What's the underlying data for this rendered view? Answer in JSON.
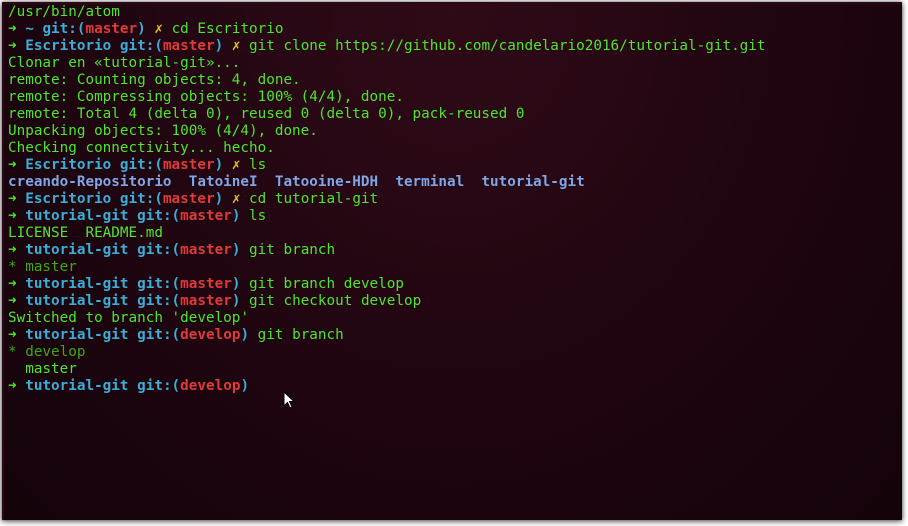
{
  "terminal": {
    "lines": [
      {
        "type": "output",
        "text": "/usr/bin/atom"
      },
      {
        "type": "prompt",
        "arrow": "➜",
        "dir": "~",
        "git": "git:(",
        "branch": "master",
        "git_close": ")",
        "dirty": "✗",
        "command": "cd Escritorio"
      },
      {
        "type": "prompt",
        "arrow": "➜",
        "dir": "Escritorio",
        "git": "git:(",
        "branch": "master",
        "git_close": ")",
        "dirty": "✗",
        "command": "git clone https://github.com/candelario2016/tutorial-git.git"
      },
      {
        "type": "output",
        "text": "Clonar en «tutorial-git»..."
      },
      {
        "type": "output",
        "text": "remote: Counting objects: 4, done."
      },
      {
        "type": "output",
        "text": "remote: Compressing objects: 100% (4/4), done."
      },
      {
        "type": "output",
        "text": "remote: Total 4 (delta 0), reused 0 (delta 0), pack-reused 0"
      },
      {
        "type": "output",
        "text": "Unpacking objects: 100% (4/4), done."
      },
      {
        "type": "output",
        "text": "Checking connectivity... hecho."
      },
      {
        "type": "prompt",
        "arrow": "➜",
        "dir": "Escritorio",
        "git": "git:(",
        "branch": "master",
        "git_close": ")",
        "dirty": "✗",
        "command": "ls"
      },
      {
        "type": "ls",
        "text": "creando-Repositorio  TatoineI  Tatooine-HDH  terminal  tutorial-git"
      },
      {
        "type": "prompt",
        "arrow": "➜",
        "dir": "Escritorio",
        "git": "git:(",
        "branch": "master",
        "git_close": ")",
        "dirty": "✗",
        "command": "cd tutorial-git"
      },
      {
        "type": "prompt",
        "arrow": "➜",
        "dir": "tutorial-git",
        "git": "git:(",
        "branch": "master",
        "git_close": ")",
        "dirty": "",
        "command": "ls"
      },
      {
        "type": "output",
        "text": "LICENSE  README.md"
      },
      {
        "type": "prompt",
        "arrow": "➜",
        "dir": "tutorial-git",
        "git": "git:(",
        "branch": "master",
        "git_close": ")",
        "dirty": "",
        "command": "git branch"
      },
      {
        "type": "branch-current",
        "text": "* master"
      },
      {
        "type": "prompt",
        "arrow": "➜",
        "dir": "tutorial-git",
        "git": "git:(",
        "branch": "master",
        "git_close": ")",
        "dirty": "",
        "command": "git branch develop"
      },
      {
        "type": "prompt",
        "arrow": "➜",
        "dir": "tutorial-git",
        "git": "git:(",
        "branch": "master",
        "git_close": ")",
        "dirty": "",
        "command": "git checkout develop"
      },
      {
        "type": "output",
        "text": "Switched to branch 'develop'"
      },
      {
        "type": "prompt",
        "arrow": "➜",
        "dir": "tutorial-git",
        "git": "git:(",
        "branch": "develop",
        "git_close": ")",
        "dirty": "",
        "command": "git branch"
      },
      {
        "type": "branch-current",
        "text": "* develop"
      },
      {
        "type": "branch-other",
        "text": "  master"
      },
      {
        "type": "prompt",
        "arrow": "➜",
        "dir": "tutorial-git",
        "git": "git:(",
        "branch": "develop",
        "git_close": ")",
        "dirty": "",
        "command": ""
      }
    ]
  },
  "colors": {
    "background": "#1f0510",
    "prompt_arrow": "#4ee52f",
    "directory": "#3aaed6",
    "branch": "#e03a3a",
    "dirty_marker": "#e8c21b",
    "output": "#4ee52f",
    "ls_directory": "#7fa6e6"
  },
  "icons": {
    "cursor": "mouse-pointer-icon"
  }
}
